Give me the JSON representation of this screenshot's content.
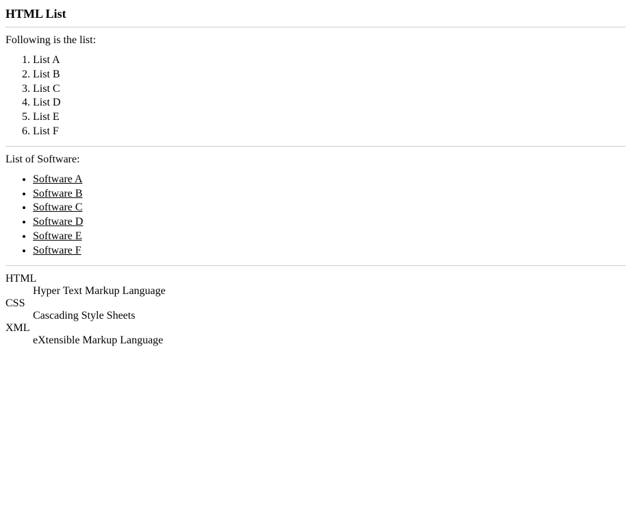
{
  "heading": "HTML List",
  "intro1": "Following is the list:",
  "ordered_items": [
    "List A",
    "List B",
    "List C",
    "List D",
    "List E",
    "List F"
  ],
  "intro2": "List of Software:",
  "software_items": [
    "Software A",
    "Software B",
    "Software C",
    "Software D",
    "Software E",
    "Software F"
  ],
  "definitions": [
    {
      "term": "HTML",
      "desc": "Hyper Text Markup Language"
    },
    {
      "term": "CSS",
      "desc": "Cascading Style Sheets"
    },
    {
      "term": "XML",
      "desc": "eXtensible Markup Language"
    }
  ]
}
